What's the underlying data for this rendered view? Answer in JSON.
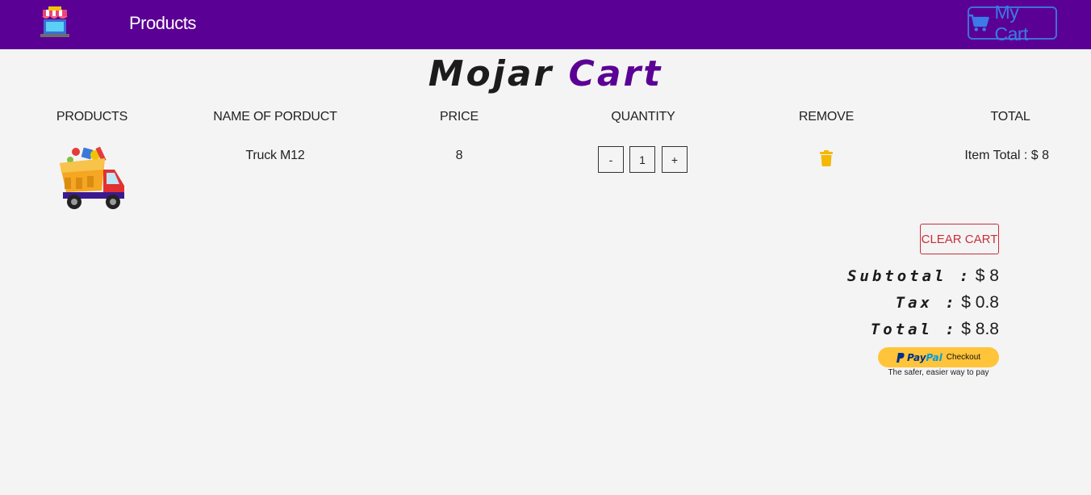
{
  "nav": {
    "products_link": "Products",
    "cart_label": "My Cart",
    "logo_icon": "store-icon",
    "cart_icon": "cart-icon"
  },
  "title": {
    "word1": "Mojar",
    "word2": "Cart"
  },
  "table": {
    "headers": [
      "PRODUCTS",
      "NAME OF PORDUCT",
      "PRICE",
      "QUANTITY",
      "REMOVE",
      "TOTAL"
    ],
    "rows": [
      {
        "image_icon": "truck-icon",
        "name": "Truck M12",
        "price": "8",
        "decrement_label": "-",
        "quantity": "1",
        "increment_label": "+",
        "remove_icon": "trash-icon",
        "item_total": "Item Total : $ 8"
      }
    ]
  },
  "actions": {
    "clear_cart": "CLEAR CART"
  },
  "summary": {
    "subtotal_label": "Subtotal :",
    "subtotal_value": "$ 8",
    "tax_label": "Tax :",
    "tax_value": "$ 0.8",
    "total_label": "Total :",
    "total_value": "$ 8.8"
  },
  "paypal": {
    "pay": "Pay",
    "pal": "Pal",
    "checkout": "Checkout",
    "tagline": "The safer, easier way to pay"
  },
  "colors": {
    "navbar": "#5b0094",
    "accent_purple": "#5b0094",
    "cart_blue": "#3a7be9",
    "danger_red": "#c92e3a",
    "trash_yellow": "#f5b800",
    "paypal_yellow": "#ffc439"
  }
}
